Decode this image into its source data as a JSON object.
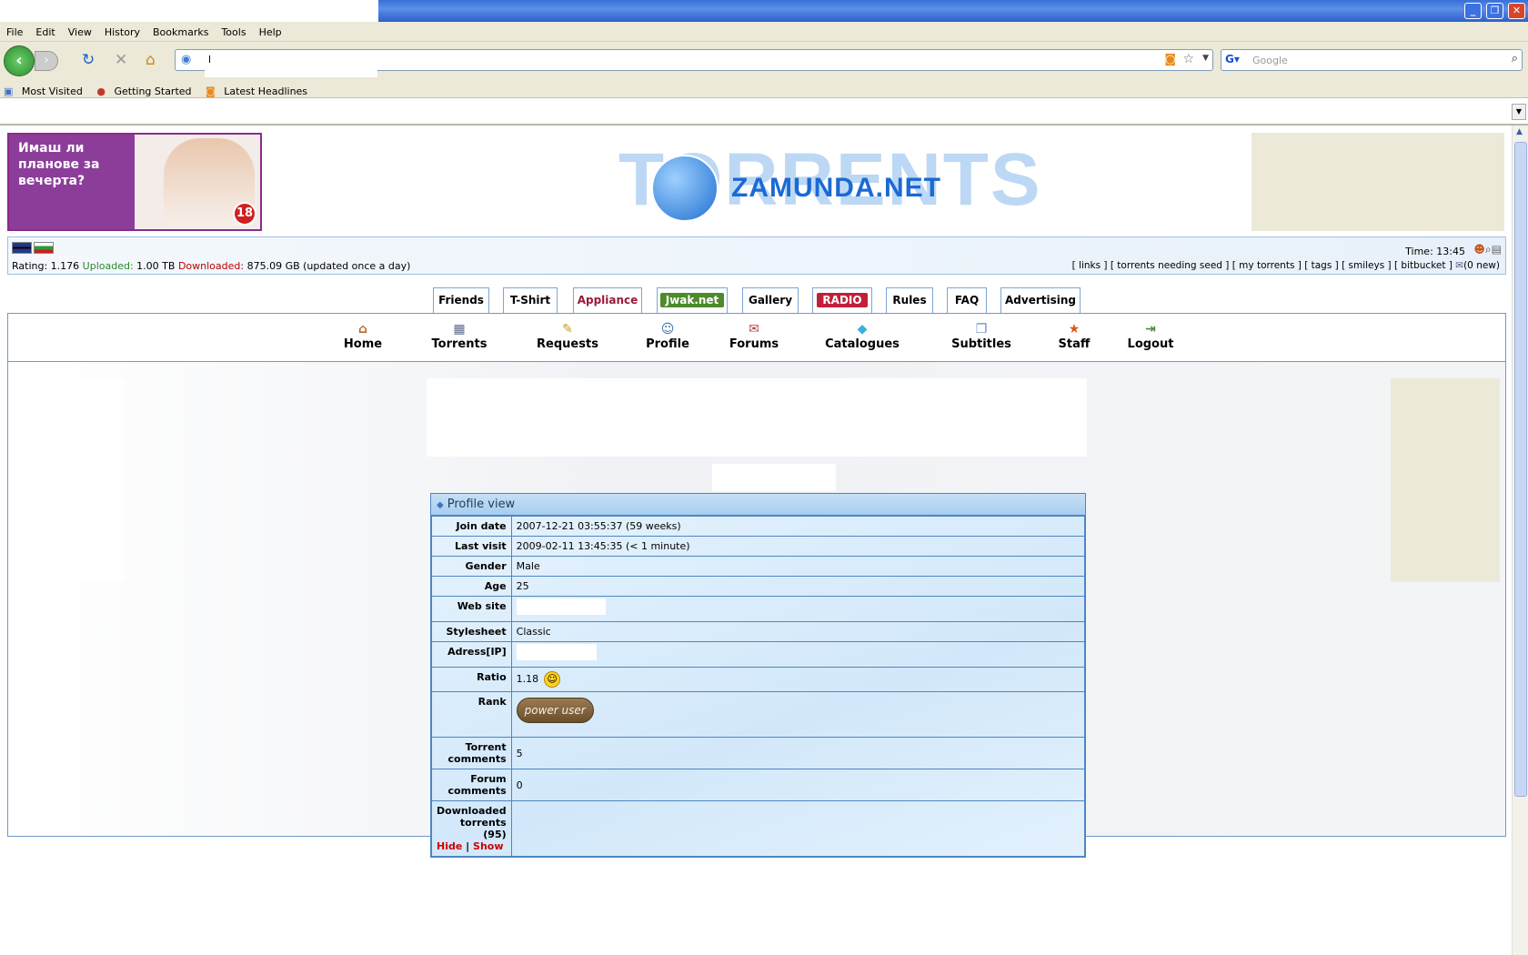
{
  "browser": {
    "menu": [
      "File",
      "Edit",
      "View",
      "History",
      "Bookmarks",
      "Tools",
      "Help"
    ],
    "url": "l",
    "search_placeholder": "Google",
    "bookmarks": [
      "Most Visited",
      "Getting Started",
      "Latest Headlines"
    ]
  },
  "banner_ad": {
    "text": "Имаш ли плановe за вечерта?",
    "badge": "18"
  },
  "logo": {
    "big": "TORRENTS",
    "name": "ZAMUNDA.NET"
  },
  "userbar": {
    "rating_label": "Rating:",
    "rating": "1.176",
    "uploaded_label": "Uploaded:",
    "uploaded": "1.00 TB",
    "downloaded_label": "Downloaded:",
    "downloaded": "875.09 GB (updated once a day)",
    "time_label": "Time:",
    "time": "13:45",
    "links": "[ links ] [ torrents needing seed ] [ my torrents ] [ tags ] [ smileys ] [ bitbucket ]",
    "new_msgs": "(0 new)"
  },
  "topnav": [
    {
      "label": "Friends"
    },
    {
      "label": "T-Shirt"
    },
    {
      "label": "Appliance",
      "color": "#9a1a3a"
    },
    {
      "label": "Jwak.net",
      "pill": "#4c8a2a"
    },
    {
      "label": "Gallery"
    },
    {
      "label": "RADIO",
      "pill": "#c0203a"
    },
    {
      "label": "Rules"
    },
    {
      "label": "FAQ"
    },
    {
      "label": "Advertising"
    }
  ],
  "mainnav": [
    {
      "label": "Home",
      "icon": "home-icon"
    },
    {
      "label": "Torrents",
      "icon": "torrents-icon"
    },
    {
      "label": "Requests",
      "icon": "requests-icon"
    },
    {
      "label": "Profile",
      "icon": "profile-icon"
    },
    {
      "label": "Forums",
      "icon": "forums-icon"
    },
    {
      "label": "Catalogues",
      "icon": "catalogues-icon"
    },
    {
      "label": "Subtitles",
      "icon": "subtitles-icon"
    },
    {
      "label": "Staff",
      "icon": "staff-icon"
    },
    {
      "label": "Logout",
      "icon": "logout-icon"
    }
  ],
  "profile": {
    "title": "Profile view",
    "rows": {
      "join_date": {
        "label": "Join date",
        "value": "2007-12-21 03:55:37 (59 weeks)"
      },
      "last_visit": {
        "label": "Last visit",
        "value": "2009-02-11 13:45:35 (< 1 minute)"
      },
      "gender": {
        "label": "Gender",
        "value": "Male"
      },
      "age": {
        "label": "Age",
        "value": "25"
      },
      "website": {
        "label": "Web site",
        "value": ""
      },
      "stylesheet": {
        "label": "Stylesheet",
        "value": "Classic"
      },
      "address_ip": {
        "label": "Adress[IP]",
        "value": ""
      },
      "ratio": {
        "label": "Ratio",
        "value": "1.18"
      },
      "rank": {
        "label": "Rank",
        "value": "power user"
      },
      "torrent_comments": {
        "label": "Torrent comments",
        "value": "5"
      },
      "forum_comments": {
        "label": "Forum comments",
        "value": "0"
      },
      "downloaded_torrents": {
        "label": "Downloaded torrents (95)",
        "hide": "Hide",
        "sep": "|",
        "show": "Show"
      }
    }
  }
}
